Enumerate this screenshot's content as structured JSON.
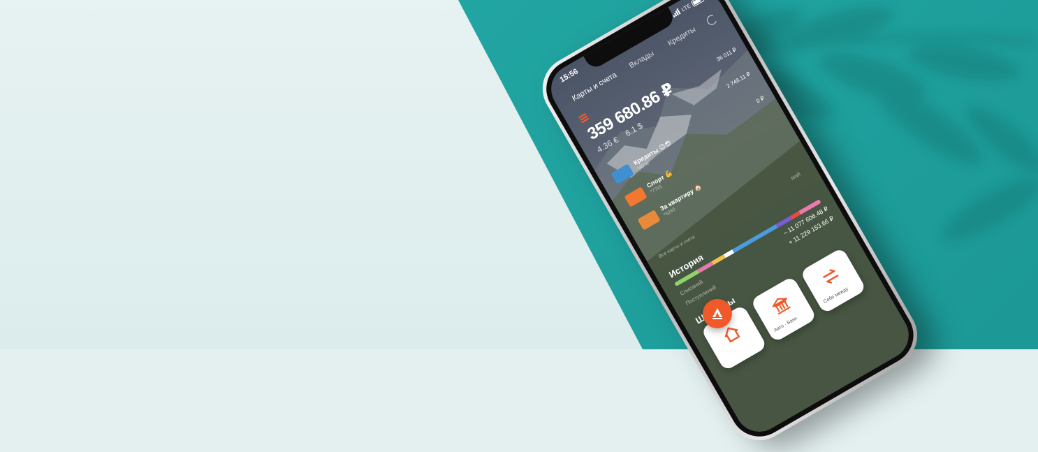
{
  "status": {
    "time": "15:56",
    "network": "LTE"
  },
  "tabs": {
    "cards": "Карты и счета",
    "deposits": "Вклады",
    "credits": "Кредиты"
  },
  "balance": {
    "main": "359 680.86 ₽",
    "eur": "4.36 €",
    "usd": "6.1 $"
  },
  "accounts": [
    {
      "title": "Кредиты 😉😎",
      "number": "*4076",
      "amount": "36 011 ₽",
      "color": "#3f8fd2"
    },
    {
      "title": "Спорт 💪",
      "number": "*7791",
      "amount": "2 748.11 ₽",
      "color": "#f2772f"
    },
    {
      "title": "За квартиру 🏠",
      "number": "*5240",
      "amount": "0 ₽",
      "color": "#e98a3a"
    }
  ],
  "all_cards_link": "Все карты и счета",
  "month_label": "май",
  "history": {
    "title": "История",
    "debits_label": "Списаний",
    "debits_value": "– 11 077 606.48 ₽",
    "credits_label": "Поступлений",
    "credits_value": "+ 11 229 153.66 ₽"
  },
  "templates": {
    "title": "Шаблоны",
    "items": [
      {
        "label": "",
        "icon": "home-icon"
      },
      {
        "label": "Авто · Банк",
        "icon": "bank-icon"
      },
      {
        "label": "Себе между",
        "icon": "transfer-icon"
      }
    ]
  },
  "colors": {
    "accent": "#f05a2a",
    "teal": "#24aaa7",
    "light_bg": "#e4f0f0"
  },
  "fab_icon": "alfa-logo-icon"
}
